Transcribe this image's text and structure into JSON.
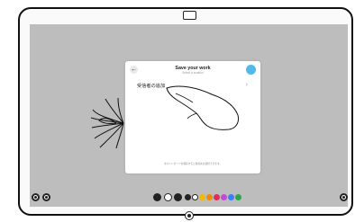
{
  "dialog": {
    "title": "Save your work",
    "subtitle": "Select a location",
    "row_label": "受信者の追加",
    "row_chevron": "›",
    "back_icon": "←",
    "footnote": "ホワイトボードを保存すると保存先を選択できます。"
  },
  "toolbar": {
    "swatches": [
      "#222222",
      "#ffffff",
      "#f5b800",
      "#f08c00",
      "#e22a5c",
      "#c04bd8",
      "#3c7dff",
      "#28a84a"
    ]
  },
  "colors": {
    "screen": "#bdbdbd",
    "confirm": "#54b8e9"
  }
}
